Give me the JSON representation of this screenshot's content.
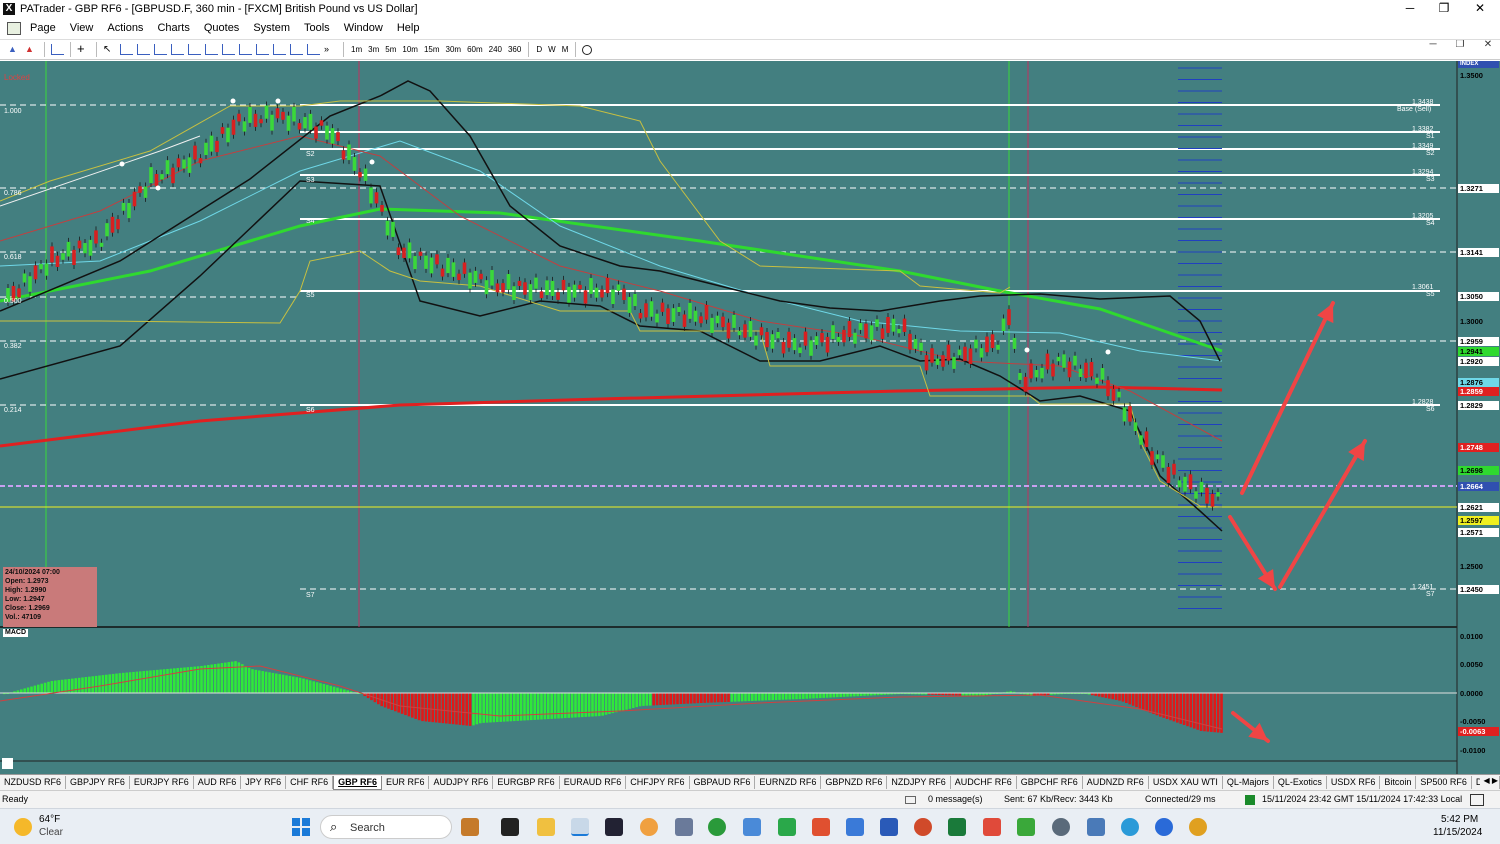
{
  "window": {
    "title": "PATrader - GBP RF6 - [GBPUSD.F, 360 min - [FXCM] British Pound vs US Dollar]",
    "minimize": "─",
    "maximize": "❐",
    "close": "✕"
  },
  "menu": [
    "Page",
    "View",
    "Actions",
    "Charts",
    "Quotes",
    "System",
    "Tools",
    "Window",
    "Help"
  ],
  "toolbar": {
    "timeframes": [
      "1m",
      "3m",
      "5m",
      "10m",
      "15m",
      "30m",
      "60m",
      "240",
      "360",
      "D",
      "W",
      "M"
    ],
    "more": "»"
  },
  "chart": {
    "locked_label": "Locked",
    "index_label": "INDEX",
    "fib_levels": [
      "1.000",
      "0.786",
      "0.618",
      "0.500",
      "0.382",
      "0.214"
    ],
    "price_axis": [
      "1.3500",
      "1.3271",
      "1.3141",
      "1.3050",
      "1.3000",
      "1.2959",
      "1.2941",
      "1.2920",
      "1.2876",
      "1.2859",
      "1.2829",
      "1.2748",
      "1.2698",
      "1.2664",
      "1.2621",
      "1.2597",
      "1.2571",
      "1.2500",
      "1.2450"
    ],
    "level_labels": [
      {
        "price": "1.3438",
        "tag": "Base (Sell)"
      },
      {
        "price": "1.3382",
        "tag": "S1"
      },
      {
        "price": "1.3349",
        "tag": "S2"
      },
      {
        "price": "1.3294",
        "tag": "S3"
      },
      {
        "price": "1.3205",
        "tag": "S4"
      },
      {
        "price": "1.3061",
        "tag": "S5"
      },
      {
        "price": "1.2828",
        "tag": "S6"
      },
      {
        "price": "1.2451",
        "tag": "S7"
      }
    ],
    "left_tags": [
      "S2",
      "S3",
      "S4",
      "S5",
      "S6",
      "S7"
    ],
    "info": {
      "date": "24/10/2024 07:00",
      "open": "Open: 1.2973",
      "high": "High: 1.2990",
      "low": "Low: 1.2947",
      "close": "Close: 1.2969",
      "vol": "Vol.: 47109"
    },
    "colors": {
      "background": "#437f80",
      "sma_green": "#2fd92f",
      "sma_red": "#e02020",
      "arrow": "#f04545"
    }
  },
  "macd": {
    "label": "MACD",
    "axis": [
      "0.0100",
      "0.0050",
      "0.0000",
      "-0.0050",
      "-0.0063",
      "-0.0100"
    ]
  },
  "tabs": [
    "NZDUSD RF6",
    "GBPJPY RF6",
    "EURJPY RF6",
    "AUD RF6",
    "JPY RF6",
    "CHF RF6",
    "GBP RF6",
    "EUR RF6",
    "AUDJPY RF6",
    "EURGBP RF6",
    "EURAUD RF6",
    "CHFJPY RF6",
    "GBPAUD RF6",
    "EURNZD RF6",
    "GBPNZD RF6",
    "NZDJPY RF6",
    "AUDCHF RF6",
    "GBPCHF RF6",
    "AUDNZD RF6",
    "USDX XAU WTI",
    "QL-Majors",
    "QL-Exotics",
    "USDX RF6",
    "Bitcoin",
    "SP500 RF6",
    "DJIA"
  ],
  "active_tab": "GBP RF6",
  "status": {
    "ready": "Ready",
    "messages": "0 message(s)",
    "traffic": "Sent: 67 Kb/Recv: 3443 Kb",
    "connection": "Connected/29 ms",
    "times": "15/11/2024 23:42 GMT  15/11/2024 17:42:33 Local"
  },
  "taskbar": {
    "temp": "64°F",
    "weather": "Clear",
    "search": "Search",
    "clock_time": "5:42 PM",
    "clock_date": "11/15/2024"
  }
}
